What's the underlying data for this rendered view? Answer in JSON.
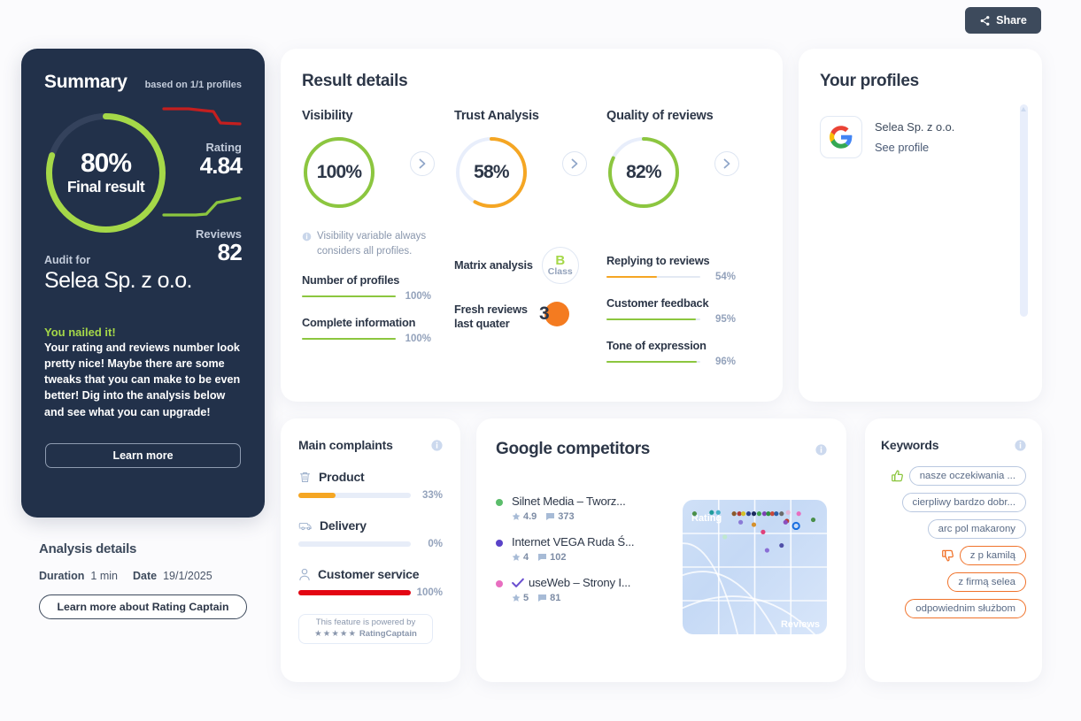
{
  "topbar": {
    "share_label": "Share",
    "share_icon": "share-icon"
  },
  "summary": {
    "title": "Summary",
    "based_on": "based on 1/1 profiles",
    "final_percent": "80%",
    "final_caption": "Final result",
    "final_value": 80,
    "rating_label": "Rating",
    "rating_value": "4.84",
    "reviews_label": "Reviews",
    "reviews_value": "82",
    "audit_for_label": "Audit for",
    "company": "Selea Sp. z o.o.",
    "nailed_title": "You nailed it!",
    "nailed_body": "Your rating and reviews number look pretty nice! Maybe there are some tweaks that you can make to be even better! Dig into the analysis below and see what you can upgrade!",
    "learn_more": "Learn more",
    "ring_color": "#a5d848",
    "rating_spark_color": "#c41f1f",
    "reviews_spark_color": "#8cc63f"
  },
  "analysis_details": {
    "title": "Analysis details",
    "duration_label": "Duration",
    "duration_value": "1 min",
    "date_label": "Date",
    "date_value": "19/1/2025",
    "button": "Learn more about Rating Captain"
  },
  "result_details": {
    "title": "Result details",
    "visibility": {
      "heading": "Visibility",
      "percent": "100%",
      "value": 100,
      "color": "#8cc63f",
      "note": "Visibility variable always considers all profiles.",
      "note_icon": "info-icon",
      "chevron_icon": "chevron-right-icon",
      "metrics": [
        {
          "label": "Number of profiles",
          "value": "100%",
          "pct": 100,
          "color": "#8cc63f"
        },
        {
          "label": "Complete information",
          "value": "100%",
          "pct": 100,
          "color": "#8cc63f"
        }
      ]
    },
    "trust": {
      "heading": "Trust Analysis",
      "percent": "58%",
      "value": 58,
      "color": "#f5a623",
      "chevron_icon": "chevron-right-icon",
      "matrix_label": "Matrix analysis",
      "matrix_class_letter": "B",
      "matrix_class_word": "Class",
      "fresh_label": "Fresh reviews last quater",
      "fresh_value": "3"
    },
    "quality": {
      "heading": "Quality of reviews",
      "percent": "82%",
      "value": 82,
      "color": "#8cc63f",
      "chevron_icon": "chevron-right-icon",
      "metrics": [
        {
          "label": "Replying to reviews",
          "value": "54%",
          "pct": 54,
          "color": "#f5a623"
        },
        {
          "label": "Customer feedback",
          "value": "95%",
          "pct": 95,
          "color": "#8cc63f"
        },
        {
          "label": "Tone of expression",
          "value": "96%",
          "pct": 96,
          "color": "#8cc63f"
        }
      ]
    }
  },
  "profiles": {
    "title": "Your profiles",
    "items": [
      {
        "logo": "google-icon",
        "name": "Selea Sp. z o.o.",
        "link": "See profile"
      }
    ]
  },
  "complaints": {
    "title": "Main complaints",
    "info_icon": "info-icon",
    "items": [
      {
        "icon": "trash-icon",
        "label": "Product",
        "value": "33%",
        "pct": 33,
        "color": "#f5a623"
      },
      {
        "icon": "truck-icon",
        "label": "Delivery",
        "value": "0%",
        "pct": 0,
        "color": "#f5a623"
      },
      {
        "icon": "person-icon",
        "label": "Customer service",
        "value": "100%",
        "pct": 100,
        "color": "#e30613"
      }
    ],
    "powered_line1": "This feature is powered by",
    "powered_stars": "★★★★★",
    "powered_brand1": "Rating",
    "powered_brand2": "Captain"
  },
  "competitors": {
    "title": "Google competitors",
    "info_icon": "info-icon",
    "items": [
      {
        "dot": "#5bbd6b",
        "name": "Silnet Media – Tworz...",
        "rating": "4.9",
        "reviews": "373",
        "verified": false
      },
      {
        "dot": "#5a43c8",
        "name": "Internet VEGA Ruda Ś...",
        "rating": "4",
        "reviews": "102",
        "verified": false
      },
      {
        "dot": "#e86ec0",
        "name": "useWeb – Strony I...",
        "rating": "5",
        "reviews": "81",
        "verified": true
      }
    ],
    "matrix": {
      "y_label": "Rating",
      "x_label": "Reviews",
      "points": [
        {
          "x": 5,
          "y": 7,
          "c": "#4a8f4a"
        },
        {
          "x": 18,
          "y": 6,
          "c": "#1f9b9b"
        },
        {
          "x": 23,
          "y": 6,
          "c": "#46b0c8"
        },
        {
          "x": 35,
          "y": 7,
          "c": "#8b5a2b"
        },
        {
          "x": 39,
          "y": 7,
          "c": "#b03a3a"
        },
        {
          "x": 42,
          "y": 7,
          "c": "#d3c02b"
        },
        {
          "x": 46,
          "y": 7,
          "c": "#2a3f8f"
        },
        {
          "x": 50,
          "y": 7,
          "c": "#1c2a5e"
        },
        {
          "x": 54,
          "y": 7,
          "c": "#3fa34d"
        },
        {
          "x": 58,
          "y": 7,
          "c": "#7d3fb5"
        },
        {
          "x": 61,
          "y": 7,
          "c": "#2f8f3f"
        },
        {
          "x": 64,
          "y": 7,
          "c": "#c9493a"
        },
        {
          "x": 67,
          "y": 7,
          "c": "#2b5fa8"
        },
        {
          "x": 71,
          "y": 7,
          "c": "#6b6b6b"
        },
        {
          "x": 76,
          "y": 6,
          "c": "#e3b7d8"
        },
        {
          "x": 84,
          "y": 7,
          "c": "#e86ec0"
        },
        {
          "x": 40,
          "y": 14,
          "c": "#8a7ad6"
        },
        {
          "x": 50,
          "y": 16,
          "c": "#d6902b"
        },
        {
          "x": 75,
          "y": 13,
          "c": "#c0392b"
        },
        {
          "x": 74,
          "y": 14,
          "c": "#8a4fc0"
        },
        {
          "x": 57,
          "y": 22,
          "c": "#e0407a"
        },
        {
          "x": 28,
          "y": 26,
          "c": "#bfe8d0"
        },
        {
          "x": 82,
          "y": 17,
          "c": "#1a6fe0",
          "ring": true
        },
        {
          "x": 60,
          "y": 37,
          "c": "#8a6fd6"
        },
        {
          "x": 71,
          "y": 33,
          "c": "#4f4fa8"
        },
        {
          "x": 95,
          "y": 12,
          "c": "#4a8f4a"
        }
      ]
    }
  },
  "keywords": {
    "title": "Keywords",
    "info_icon": "info-icon",
    "items": [
      {
        "label": "nasze oczekiwania ...",
        "sentiment": "positive",
        "icon": "thumbs-up-icon"
      },
      {
        "label": "cierpliwy bardzo dobr...",
        "sentiment": "neutral",
        "icon": null
      },
      {
        "label": "arc pol makarony",
        "sentiment": "neutral",
        "icon": null
      },
      {
        "label": "z p kamilą",
        "sentiment": "negative",
        "icon": "thumbs-down-icon"
      },
      {
        "label": "z firmą selea",
        "sentiment": "negative",
        "icon": null
      },
      {
        "label": "odpowiednim służbom",
        "sentiment": "negative",
        "icon": null
      }
    ]
  }
}
